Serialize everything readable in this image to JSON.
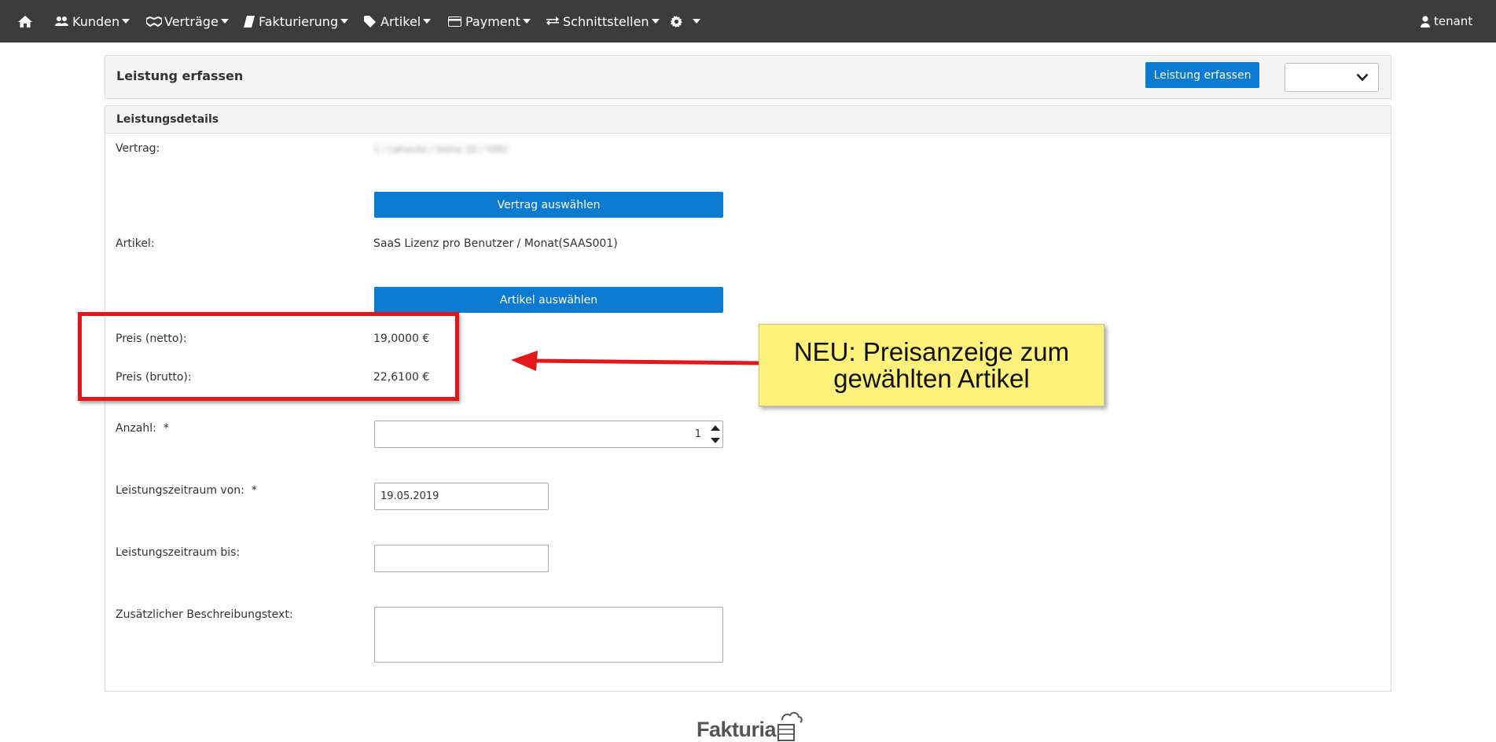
{
  "nav": {
    "home_icon": "home-icon",
    "items": [
      {
        "label": "Kunden",
        "icon": "users-icon"
      },
      {
        "label": "Verträge",
        "icon": "handshake-icon"
      },
      {
        "label": "Fakturierung",
        "icon": "book-icon"
      },
      {
        "label": "Artikel",
        "icon": "tags-icon"
      },
      {
        "label": "Payment",
        "icon": "credit-card-icon"
      },
      {
        "label": "Schnittstellen",
        "icon": "exchange-icon"
      }
    ],
    "settings_icon": "gear-icon",
    "user": {
      "label": "tenant",
      "icon": "user-icon"
    }
  },
  "header": {
    "title": "Leistung erfassen",
    "action_label": "Leistung erfassen",
    "select_value": ""
  },
  "details": {
    "title": "Leistungsdetails",
    "vertrag_label": "Vertrag:",
    "vertrag_value": "1 / Lahoute / Seine 20 / VMU",
    "vertrag_button": "Vertrag auswählen",
    "artikel_label": "Artikel:",
    "artikel_value": "SaaS Lizenz pro Benutzer / Monat(SAAS001)",
    "artikel_button": "Artikel auswählen",
    "preis_netto_label": "Preis (netto):",
    "preis_netto_value": "19,0000 €",
    "preis_brutto_label": "Preis (brutto):",
    "preis_brutto_value": "22,6100 €",
    "anzahl_label": "Anzahl:",
    "anzahl_value": "1",
    "required_mark": "*",
    "von_label": "Leistungszeitraum von:",
    "von_value": "19.05.2019",
    "bis_label": "Leistungszeitraum bis:",
    "bis_value": "",
    "beschreibung_label": "Zusätzlicher Beschreibungstext:",
    "beschreibung_value": ""
  },
  "annotation": {
    "text": "NEU: Preisanzeige zum gewählten Artikel",
    "box_color": "#e0181b",
    "note_color": "#fff27c"
  },
  "footer": {
    "logo_text": "Fakturia"
  },
  "colors": {
    "navbar": "#3c3c3c",
    "primary": "#0b7ad1",
    "panel_header": "#f5f5f5"
  }
}
